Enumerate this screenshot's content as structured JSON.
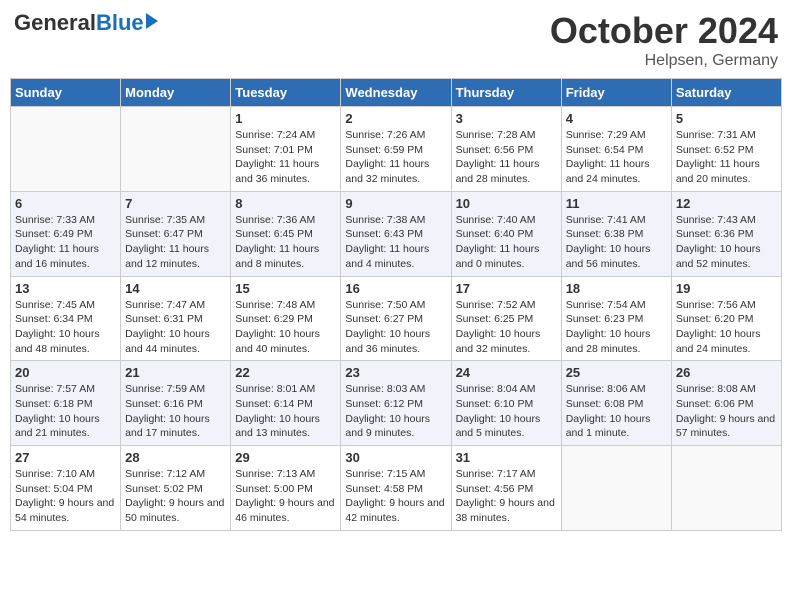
{
  "logo": {
    "general": "General",
    "blue": "Blue"
  },
  "title": "October 2024",
  "location": "Helpsen, Germany",
  "headers": [
    "Sunday",
    "Monday",
    "Tuesday",
    "Wednesday",
    "Thursday",
    "Friday",
    "Saturday"
  ],
  "weeks": [
    [
      {
        "day": "",
        "info": ""
      },
      {
        "day": "",
        "info": ""
      },
      {
        "day": "1",
        "info": "Sunrise: 7:24 AM\nSunset: 7:01 PM\nDaylight: 11 hours and 36 minutes."
      },
      {
        "day": "2",
        "info": "Sunrise: 7:26 AM\nSunset: 6:59 PM\nDaylight: 11 hours and 32 minutes."
      },
      {
        "day": "3",
        "info": "Sunrise: 7:28 AM\nSunset: 6:56 PM\nDaylight: 11 hours and 28 minutes."
      },
      {
        "day": "4",
        "info": "Sunrise: 7:29 AM\nSunset: 6:54 PM\nDaylight: 11 hours and 24 minutes."
      },
      {
        "day": "5",
        "info": "Sunrise: 7:31 AM\nSunset: 6:52 PM\nDaylight: 11 hours and 20 minutes."
      }
    ],
    [
      {
        "day": "6",
        "info": "Sunrise: 7:33 AM\nSunset: 6:49 PM\nDaylight: 11 hours and 16 minutes."
      },
      {
        "day": "7",
        "info": "Sunrise: 7:35 AM\nSunset: 6:47 PM\nDaylight: 11 hours and 12 minutes."
      },
      {
        "day": "8",
        "info": "Sunrise: 7:36 AM\nSunset: 6:45 PM\nDaylight: 11 hours and 8 minutes."
      },
      {
        "day": "9",
        "info": "Sunrise: 7:38 AM\nSunset: 6:43 PM\nDaylight: 11 hours and 4 minutes."
      },
      {
        "day": "10",
        "info": "Sunrise: 7:40 AM\nSunset: 6:40 PM\nDaylight: 11 hours and 0 minutes."
      },
      {
        "day": "11",
        "info": "Sunrise: 7:41 AM\nSunset: 6:38 PM\nDaylight: 10 hours and 56 minutes."
      },
      {
        "day": "12",
        "info": "Sunrise: 7:43 AM\nSunset: 6:36 PM\nDaylight: 10 hours and 52 minutes."
      }
    ],
    [
      {
        "day": "13",
        "info": "Sunrise: 7:45 AM\nSunset: 6:34 PM\nDaylight: 10 hours and 48 minutes."
      },
      {
        "day": "14",
        "info": "Sunrise: 7:47 AM\nSunset: 6:31 PM\nDaylight: 10 hours and 44 minutes."
      },
      {
        "day": "15",
        "info": "Sunrise: 7:48 AM\nSunset: 6:29 PM\nDaylight: 10 hours and 40 minutes."
      },
      {
        "day": "16",
        "info": "Sunrise: 7:50 AM\nSunset: 6:27 PM\nDaylight: 10 hours and 36 minutes."
      },
      {
        "day": "17",
        "info": "Sunrise: 7:52 AM\nSunset: 6:25 PM\nDaylight: 10 hours and 32 minutes."
      },
      {
        "day": "18",
        "info": "Sunrise: 7:54 AM\nSunset: 6:23 PM\nDaylight: 10 hours and 28 minutes."
      },
      {
        "day": "19",
        "info": "Sunrise: 7:56 AM\nSunset: 6:20 PM\nDaylight: 10 hours and 24 minutes."
      }
    ],
    [
      {
        "day": "20",
        "info": "Sunrise: 7:57 AM\nSunset: 6:18 PM\nDaylight: 10 hours and 21 minutes."
      },
      {
        "day": "21",
        "info": "Sunrise: 7:59 AM\nSunset: 6:16 PM\nDaylight: 10 hours and 17 minutes."
      },
      {
        "day": "22",
        "info": "Sunrise: 8:01 AM\nSunset: 6:14 PM\nDaylight: 10 hours and 13 minutes."
      },
      {
        "day": "23",
        "info": "Sunrise: 8:03 AM\nSunset: 6:12 PM\nDaylight: 10 hours and 9 minutes."
      },
      {
        "day": "24",
        "info": "Sunrise: 8:04 AM\nSunset: 6:10 PM\nDaylight: 10 hours and 5 minutes."
      },
      {
        "day": "25",
        "info": "Sunrise: 8:06 AM\nSunset: 6:08 PM\nDaylight: 10 hours and 1 minute."
      },
      {
        "day": "26",
        "info": "Sunrise: 8:08 AM\nSunset: 6:06 PM\nDaylight: 9 hours and 57 minutes."
      }
    ],
    [
      {
        "day": "27",
        "info": "Sunrise: 7:10 AM\nSunset: 5:04 PM\nDaylight: 9 hours and 54 minutes."
      },
      {
        "day": "28",
        "info": "Sunrise: 7:12 AM\nSunset: 5:02 PM\nDaylight: 9 hours and 50 minutes."
      },
      {
        "day": "29",
        "info": "Sunrise: 7:13 AM\nSunset: 5:00 PM\nDaylight: 9 hours and 46 minutes."
      },
      {
        "day": "30",
        "info": "Sunrise: 7:15 AM\nSunset: 4:58 PM\nDaylight: 9 hours and 42 minutes."
      },
      {
        "day": "31",
        "info": "Sunrise: 7:17 AM\nSunset: 4:56 PM\nDaylight: 9 hours and 38 minutes."
      },
      {
        "day": "",
        "info": ""
      },
      {
        "day": "",
        "info": ""
      }
    ]
  ]
}
